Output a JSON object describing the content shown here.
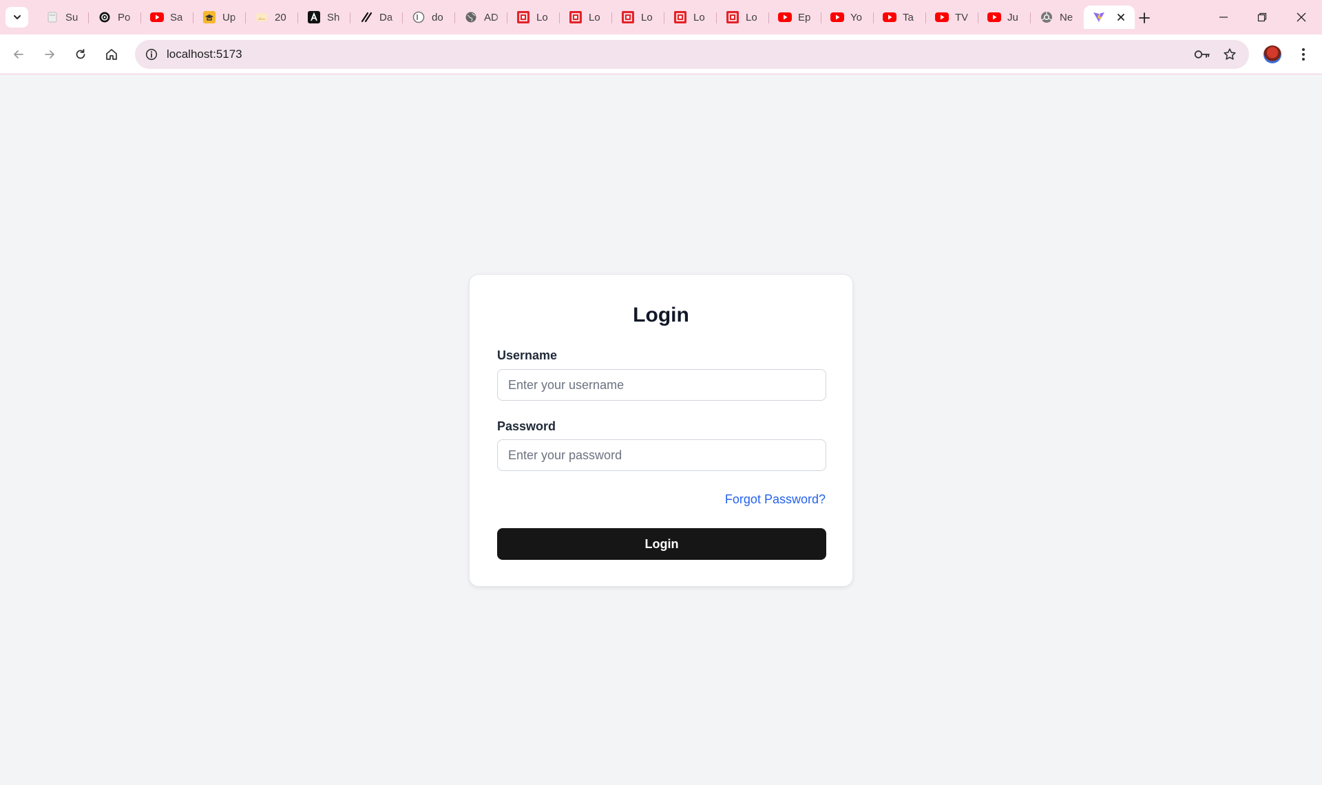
{
  "browser": {
    "tabs": [
      {
        "title": "Su",
        "icon": "chrome-newtab-icon"
      },
      {
        "title": "Po",
        "icon": "openai-icon"
      },
      {
        "title": "Sa",
        "icon": "youtube-icon"
      },
      {
        "title": "Up",
        "icon": "upgrad-icon"
      },
      {
        "title": "20",
        "icon": "image-icon"
      },
      {
        "title": "Sh",
        "icon": "shadcn-icon"
      },
      {
        "title": "Da",
        "icon": "slash-icon"
      },
      {
        "title": "do",
        "icon": "docs-icon"
      },
      {
        "title": "AD",
        "icon": "globe-icon"
      },
      {
        "title": "Lo",
        "icon": "red-logo-icon"
      },
      {
        "title": "Lo",
        "icon": "red-logo-icon"
      },
      {
        "title": "Lo",
        "icon": "red-logo-icon"
      },
      {
        "title": "Lo",
        "icon": "red-logo-icon"
      },
      {
        "title": "Lo",
        "icon": "red-logo-icon"
      },
      {
        "title": "Ep",
        "icon": "youtube-icon"
      },
      {
        "title": "Yo",
        "icon": "youtube-icon"
      },
      {
        "title": "Ta",
        "icon": "youtube-icon"
      },
      {
        "title": "TV",
        "icon": "youtube-icon"
      },
      {
        "title": "Ju",
        "icon": "youtube-icon"
      },
      {
        "title": "Ne",
        "icon": "chrome-icon"
      }
    ],
    "active_tab_icon": "vite-icon",
    "url": "localhost:5173"
  },
  "login": {
    "title": "Login",
    "username_label": "Username",
    "username_placeholder": "Enter your username",
    "password_label": "Password",
    "password_placeholder": "Enter your password",
    "forgot_link": "Forgot Password?",
    "submit_label": "Login"
  },
  "colors": {
    "page_bg": "#f3f4f6",
    "tabstrip_bg": "#fbdde8",
    "link": "#2563eb",
    "button_bg": "#161616"
  }
}
